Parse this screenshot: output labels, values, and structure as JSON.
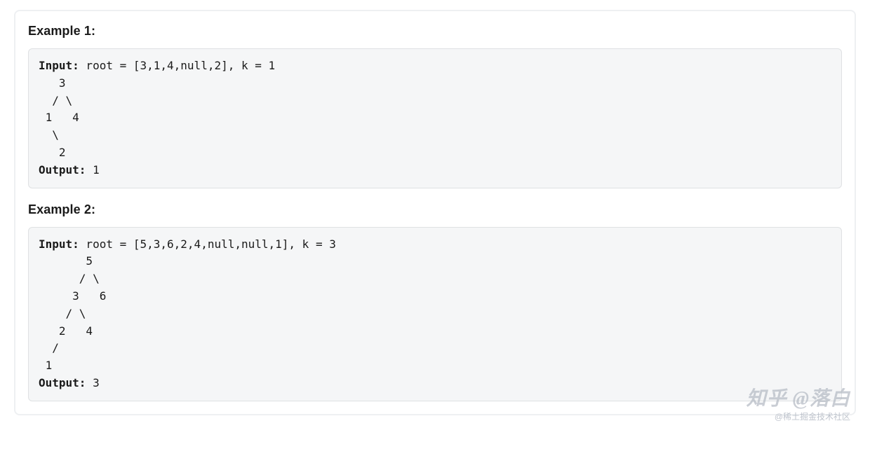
{
  "examples": [
    {
      "heading": "Example 1:",
      "input_label": "Input:",
      "input_value": " root = [3,1,4,null,2], k = 1",
      "tree": "   3\n  / \\\n 1   4\n  \\\n   2",
      "output_label": "Output:",
      "output_value": " 1"
    },
    {
      "heading": "Example 2:",
      "input_label": "Input:",
      "input_value": " root = [5,3,6,2,4,null,null,1], k = 3",
      "tree": "       5\n      / \\\n     3   6\n    / \\\n   2   4\n  /\n 1",
      "output_label": "Output:",
      "output_value": " 3"
    }
  ],
  "watermark": {
    "main": "知乎 @落白",
    "sub": "@稀土掘金技术社区"
  }
}
